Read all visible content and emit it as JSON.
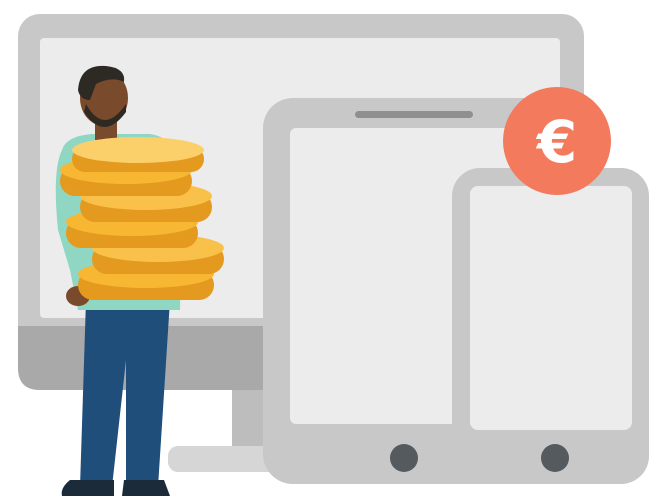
{
  "illustration": {
    "badge": {
      "symbol": "€",
      "icon": "euro-icon"
    },
    "devices": [
      "desktop-monitor",
      "tablet",
      "smartphone"
    ],
    "figure": {
      "description_icon": "person-holding-coin-stack",
      "coin_count": 6
    },
    "colors": {
      "device_frame": "#c8c8c8",
      "device_frame_dark": "#a9a9a9",
      "device_screen": "#ececec",
      "device_button": "#555a5e",
      "badge": "#f47a5e",
      "coin": "#f7b733",
      "coin_shadow": "#e49a1e",
      "shirt": "#8fd6c3",
      "pants": "#1f4e7a",
      "skin": "#7a4a2c",
      "hair": "#2d2a24"
    }
  }
}
